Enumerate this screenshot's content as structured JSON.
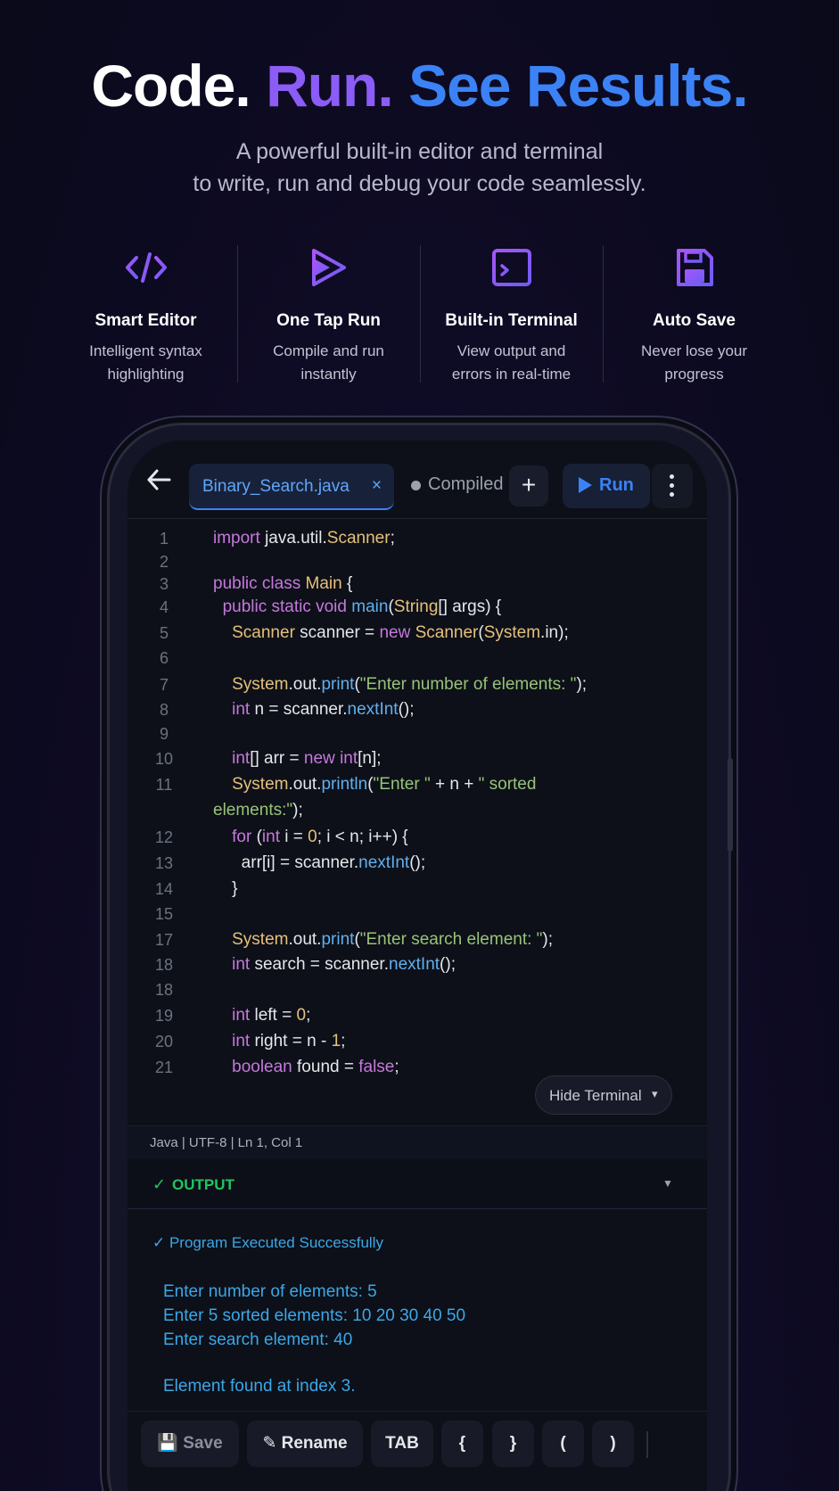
{
  "hero": {
    "title_code": "Code.",
    "title_run": "Run.",
    "title_see": "See Results.",
    "subtitle_line1": "A powerful built-in editor and terminal",
    "subtitle_line2": "to write, run and debug your code seamlessly."
  },
  "features": [
    {
      "icon": "code-brackets-icon",
      "title": "Smart Editor",
      "desc1": "Intelligent syntax",
      "desc2": "highlighting"
    },
    {
      "icon": "fast-forward-play-icon",
      "title": "One Tap Run",
      "desc1": "Compile and run",
      "desc2": "instantly"
    },
    {
      "icon": "terminal-icon",
      "title": "Built-in Terminal",
      "desc1": "View output and",
      "desc2": "errors in real-time"
    },
    {
      "icon": "floppy-disk-icon",
      "title": "Auto Save",
      "desc1": "Never lose your",
      "desc2": "progress"
    }
  ],
  "colors": {
    "accent_purple": "#8b5cf6",
    "accent_blue": "#3b82f6",
    "success_green": "#22c55e",
    "output_blue": "#3ba7e8"
  },
  "editor": {
    "tab_label": "Binary_Search.java",
    "tab_close": "×",
    "compiled_label": "Compiled",
    "plus_label": "+",
    "run_label": "Run",
    "hide_terminal_label": "Hide Terminal",
    "status_text": "Java | UTF-8 | Ln 1, Col 1"
  },
  "code_lines": [
    {
      "n": "1"
    },
    {
      "n": "2"
    },
    {
      "n": "3"
    },
    {
      "n": "4"
    },
    {
      "n": "5"
    },
    {
      "n": "6"
    },
    {
      "n": "7"
    },
    {
      "n": "8"
    },
    {
      "n": "9"
    },
    {
      "n": "10"
    },
    {
      "n": "11"
    },
    {
      "n": "12"
    },
    {
      "n": "13"
    },
    {
      "n": "14"
    },
    {
      "n": "15"
    },
    {
      "n": "17"
    },
    {
      "n": "18"
    },
    {
      "n": "18"
    },
    {
      "n": "19"
    },
    {
      "n": "20"
    },
    {
      "n": "21"
    }
  ],
  "output": {
    "check": "✓",
    "label": "OUTPUT",
    "success": "✓ Program Executed Successfully",
    "lines": [
      "Enter number of elements: 5",
      "Enter 5 sorted elements: 10 20 30 40 50",
      "Enter search element: 40",
      "Element found at index 3."
    ]
  },
  "toolbar": {
    "save": "Save",
    "rename": "Rename",
    "tab": "TAB",
    "brace_open": "{",
    "brace_close": "}",
    "paren_open": "(",
    "paren_close": ")"
  }
}
